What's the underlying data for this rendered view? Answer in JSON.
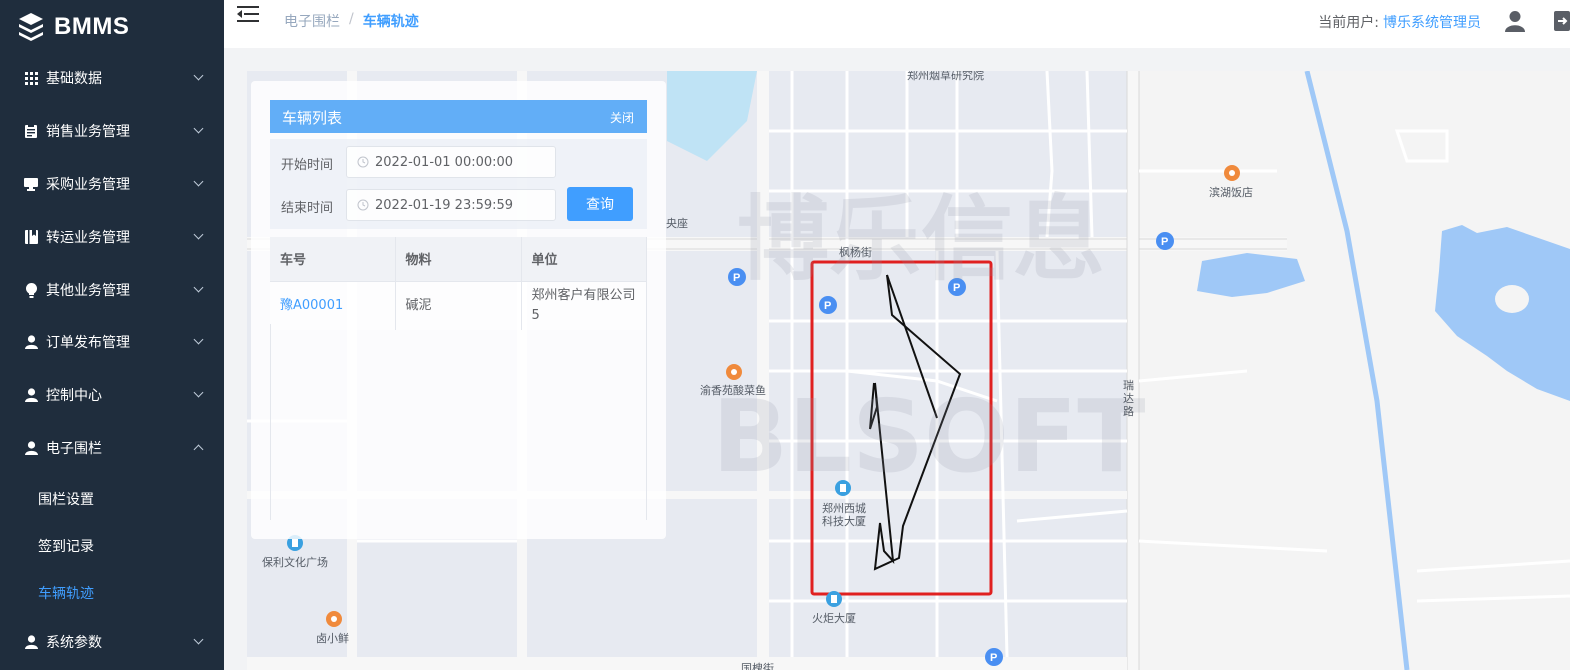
{
  "app": {
    "title": "BMMS"
  },
  "sidebar": {
    "items": [
      {
        "label": "基础数据",
        "icon": "grid-icon",
        "expanded": false
      },
      {
        "label": "销售业务管理",
        "icon": "clipboard-icon",
        "expanded": false
      },
      {
        "label": "采购业务管理",
        "icon": "monitor-icon",
        "expanded": false
      },
      {
        "label": "转运业务管理",
        "icon": "book-icon",
        "expanded": false
      },
      {
        "label": "其他业务管理",
        "icon": "bulb-icon",
        "expanded": false
      },
      {
        "label": "订单发布管理",
        "icon": "user-icon",
        "expanded": false
      },
      {
        "label": "控制中心",
        "icon": "user-icon",
        "expanded": false
      },
      {
        "label": "电子围栏",
        "icon": "user-icon",
        "expanded": true
      },
      {
        "label": "系统参数",
        "icon": "user-icon",
        "expanded": false
      }
    ],
    "subitems": [
      {
        "label": "围栏设置",
        "active": false
      },
      {
        "label": "签到记录",
        "active": false
      },
      {
        "label": "车辆轨迹",
        "active": true
      }
    ]
  },
  "header": {
    "breadcrumb": [
      "电子围栏",
      "车辆轨迹"
    ],
    "separator": "/",
    "user_prefix": "当前用户:",
    "user_name": "博乐系统管理员"
  },
  "panel": {
    "title": "车辆列表",
    "close_label": "关闭",
    "start_label": "开始时间",
    "start_value": "2022-01-01 00:00:00",
    "end_label": "结束时间",
    "end_value": "2022-01-19 23:59:59",
    "query_label": "查询",
    "columns": [
      "车号",
      "物料",
      "单位"
    ],
    "rows": [
      {
        "plate": "豫A00001",
        "material": "碱泥",
        "company": "郑州客户有限公司5"
      }
    ]
  },
  "map": {
    "labels": {
      "research": "郑州烟草研究院",
      "binhu": "滨湖饭店",
      "fengyang": "枫杨街",
      "yangyan": "央座",
      "yuxiang": "渝香苑酸菜鱼",
      "ruida_1": "瑞",
      "ruida_2": "达",
      "ruida_3": "路",
      "xicheng_1": "郑州西城",
      "xicheng_2": "科技大厦",
      "baoli": "保利文化广场",
      "huoju": "火炬大厦",
      "luxiaoxian": "卤小鲜",
      "guohuai": "国槐街"
    },
    "watermark_cn": "博乐信息",
    "watermark_en": "BLSOFT",
    "fence_color": "#e02020",
    "track_color": "#111111"
  },
  "colors": {
    "sidebar_bg": "#1f2d3d",
    "accent": "#409eff",
    "panel_header": "#62aef7"
  }
}
